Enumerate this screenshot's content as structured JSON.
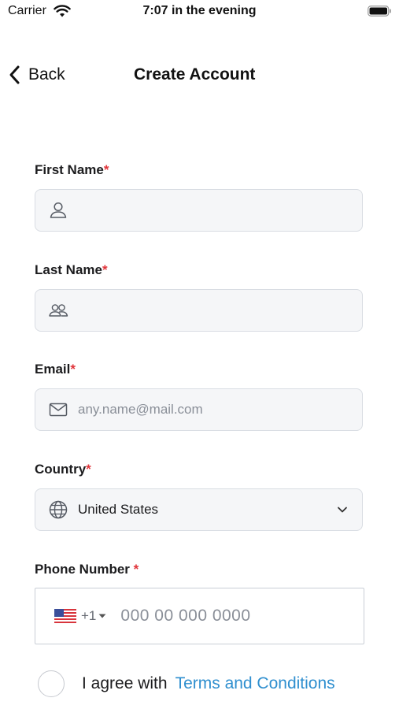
{
  "status_bar": {
    "carrier": "Carrier",
    "time": "7:07 in the evening",
    "icons": [
      "wifi-icon",
      "battery-icon"
    ]
  },
  "nav": {
    "back_label": "Back",
    "title": "Create Account"
  },
  "form": {
    "first_name": {
      "label": "First Name",
      "required_mark": "*",
      "value": "",
      "icon": "person-icon"
    },
    "last_name": {
      "label": "Last Name",
      "required_mark": "*",
      "value": "",
      "icon": "people-icon"
    },
    "email": {
      "label": "Email",
      "required_mark": "*",
      "placeholder": "any.name@mail.com",
      "icon": "mail-icon"
    },
    "country": {
      "label": "Country",
      "required_mark": "*",
      "value": "United States",
      "icon": "globe-icon"
    },
    "phone": {
      "label": "Phone Number ",
      "required_mark": "*",
      "dial_code": "+1",
      "placeholder": "000 00 000 0000",
      "flag": "us-flag-icon"
    }
  },
  "agree": {
    "text": "I agree with",
    "link": "Terms and Conditions"
  },
  "colors": {
    "required": "#e0343a",
    "link": "#2f8fcf",
    "input_bg": "#f5f6f8",
    "input_border": "#d9dde3"
  }
}
